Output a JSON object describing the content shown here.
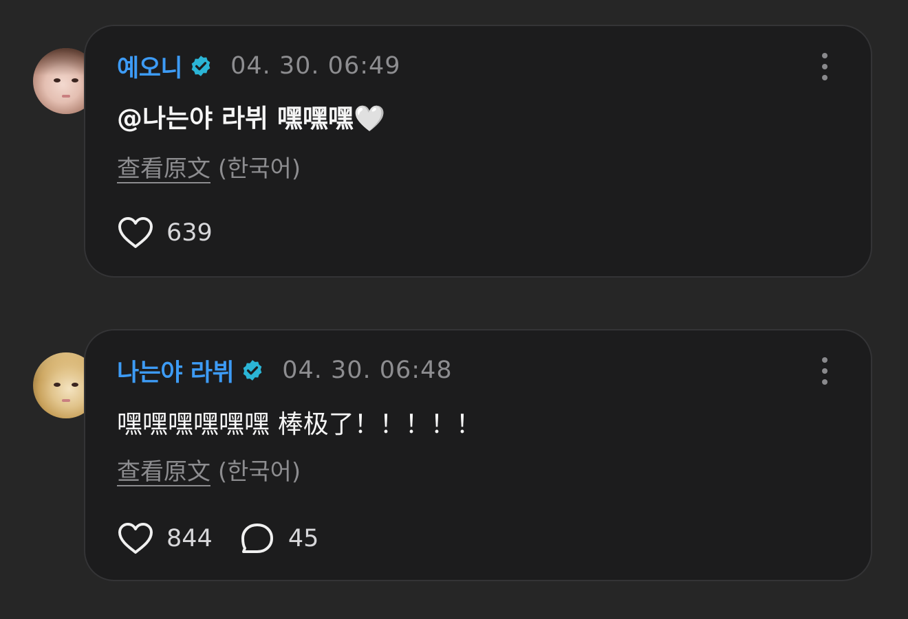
{
  "comments": [
    {
      "author": "예오니",
      "timestamp": "04. 30. 06:49",
      "text": "@나는야 라뷔 嘿嘿嘿🤍",
      "translate_link": "查看原文",
      "translate_lang": "(한국어)",
      "likes": "639"
    },
    {
      "author": "나는야 라뷔",
      "timestamp": "04. 30. 06:48",
      "text": "嘿嘿嘿嘿嘿嘿 棒极了！！！！！",
      "translate_link": "查看原文",
      "translate_lang": "(한국어)",
      "likes": "844",
      "replies": "45"
    }
  ],
  "colors": {
    "background": "#262626",
    "card": "#1c1c1d",
    "name": "#3d9bf5",
    "verified": "#2bb5d6",
    "muted": "#8d8d90"
  }
}
